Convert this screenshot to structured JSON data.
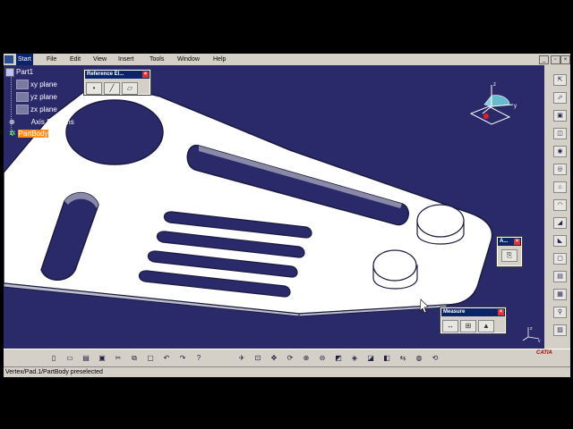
{
  "menu": {
    "items": [
      "Start",
      "File",
      "Edit",
      "View",
      "Insert",
      "Tools",
      "Window",
      "Help"
    ]
  },
  "tree": {
    "root": "Part1",
    "planes": [
      "xy plane",
      "yz plane",
      "zx plane"
    ],
    "axis": "Axis Systems",
    "body": "PartBody"
  },
  "reference_panel": {
    "title": "Reference El..."
  },
  "measure_panel": {
    "title": "Measure"
  },
  "small_panel": {
    "title": "A..."
  },
  "compass": {
    "x": "x",
    "y": "y",
    "z": "z"
  },
  "triad": {
    "x": "x",
    "y": "y",
    "z": "z"
  },
  "status": {
    "text": "Vertex/Pad.1/PartBody preselected"
  },
  "brand": {
    "text": "CATIA"
  },
  "colors": {
    "background": "#2a2a6a",
    "part": "#ffffff",
    "selection": "#ff8c1a",
    "titlebar": "#0a246a"
  },
  "icons": {
    "right_toolbar": [
      "cursor-icon",
      "sketch-icon",
      "pad-icon",
      "pocket-icon",
      "shaft-icon",
      "hole-icon",
      "rib-icon",
      "fillet-icon",
      "chamfer-icon",
      "draft-icon",
      "shell-icon",
      "thickness-icon",
      "pattern-icon",
      "constraint-icon",
      "analysis-icon"
    ],
    "bottom_toolbar": [
      "new-icon",
      "open-icon",
      "save-icon",
      "print-icon",
      "cut-icon",
      "copy-icon",
      "paste-icon",
      "undo-icon",
      "redo-icon",
      "help-icon",
      "fly-icon",
      "fit-all-icon",
      "pan-icon",
      "rotate-icon",
      "zoom-in-icon",
      "zoom-out-icon",
      "normal-view-icon",
      "iso-view-icon",
      "render-style-icon",
      "hide-show-icon",
      "swap-icon",
      "apply-material-icon",
      "update-icon"
    ]
  }
}
